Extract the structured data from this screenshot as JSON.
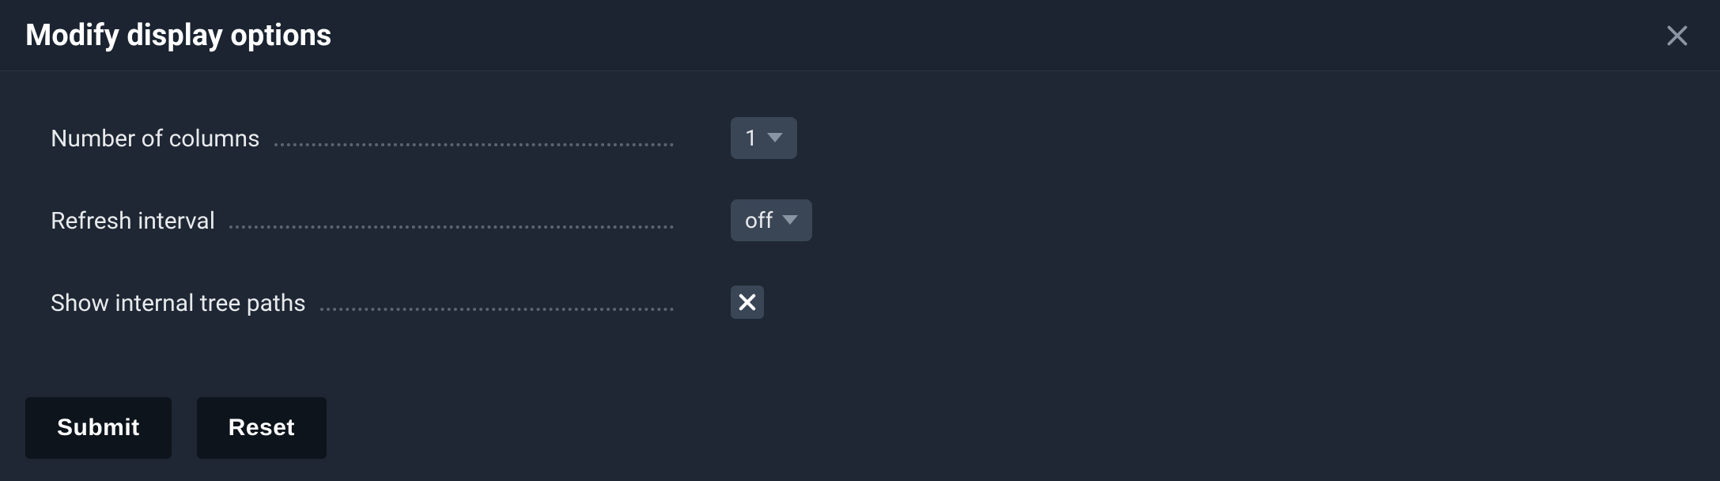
{
  "header": {
    "title": "Modify display options"
  },
  "fields": {
    "columns": {
      "label": "Number of columns",
      "value": "1"
    },
    "refresh": {
      "label": "Refresh interval",
      "value": "off"
    },
    "tree_paths": {
      "label": "Show internal tree paths",
      "checked": false
    }
  },
  "buttons": {
    "submit": "Submit",
    "reset": "Reset"
  }
}
